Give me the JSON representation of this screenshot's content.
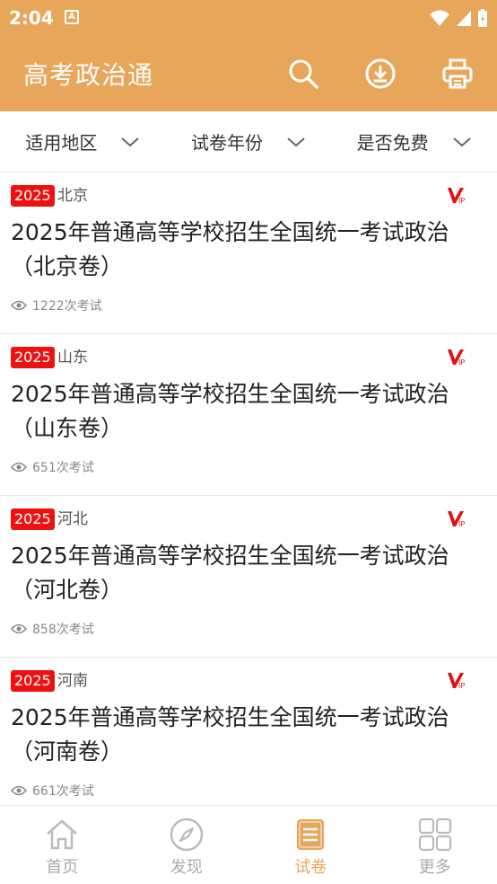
{
  "status_bar": {
    "time": "2:04",
    "notification_icon": "A"
  },
  "app_bar": {
    "title": "高考政治通",
    "icons": [
      "search-icon",
      "download-icon",
      "printer-icon"
    ]
  },
  "filters": [
    {
      "label": "适用地区"
    },
    {
      "label": "试卷年份"
    },
    {
      "label": "是否免费"
    }
  ],
  "papers": [
    {
      "year": "2025",
      "region": "北京",
      "title": "2025年普通高等学校招生全国统一考试政治（北京卷）",
      "views": "1222次考试",
      "vip": true
    },
    {
      "year": "2025",
      "region": "山东",
      "title": "2025年普通高等学校招生全国统一考试政治（山东卷）",
      "views": "651次考试",
      "vip": true
    },
    {
      "year": "2025",
      "region": "河北",
      "title": "2025年普通高等学校招生全国统一考试政治（河北卷）",
      "views": "858次考试",
      "vip": true
    },
    {
      "year": "2025",
      "region": "河南",
      "title": "2025年普通高等学校招生全国统一考试政治（河南卷）",
      "views": "661次考试",
      "vip": true
    }
  ],
  "bottom_nav": [
    {
      "label": "首页",
      "icon": "home-icon",
      "active": false
    },
    {
      "label": "发现",
      "icon": "compass-icon",
      "active": false
    },
    {
      "label": "试卷",
      "icon": "paper-icon",
      "active": true
    },
    {
      "label": "更多",
      "icon": "grid-icon",
      "active": false
    }
  ],
  "colors": {
    "accent": "#E8A65A",
    "year_badge": "#EE1111",
    "vip": "#E11111"
  }
}
